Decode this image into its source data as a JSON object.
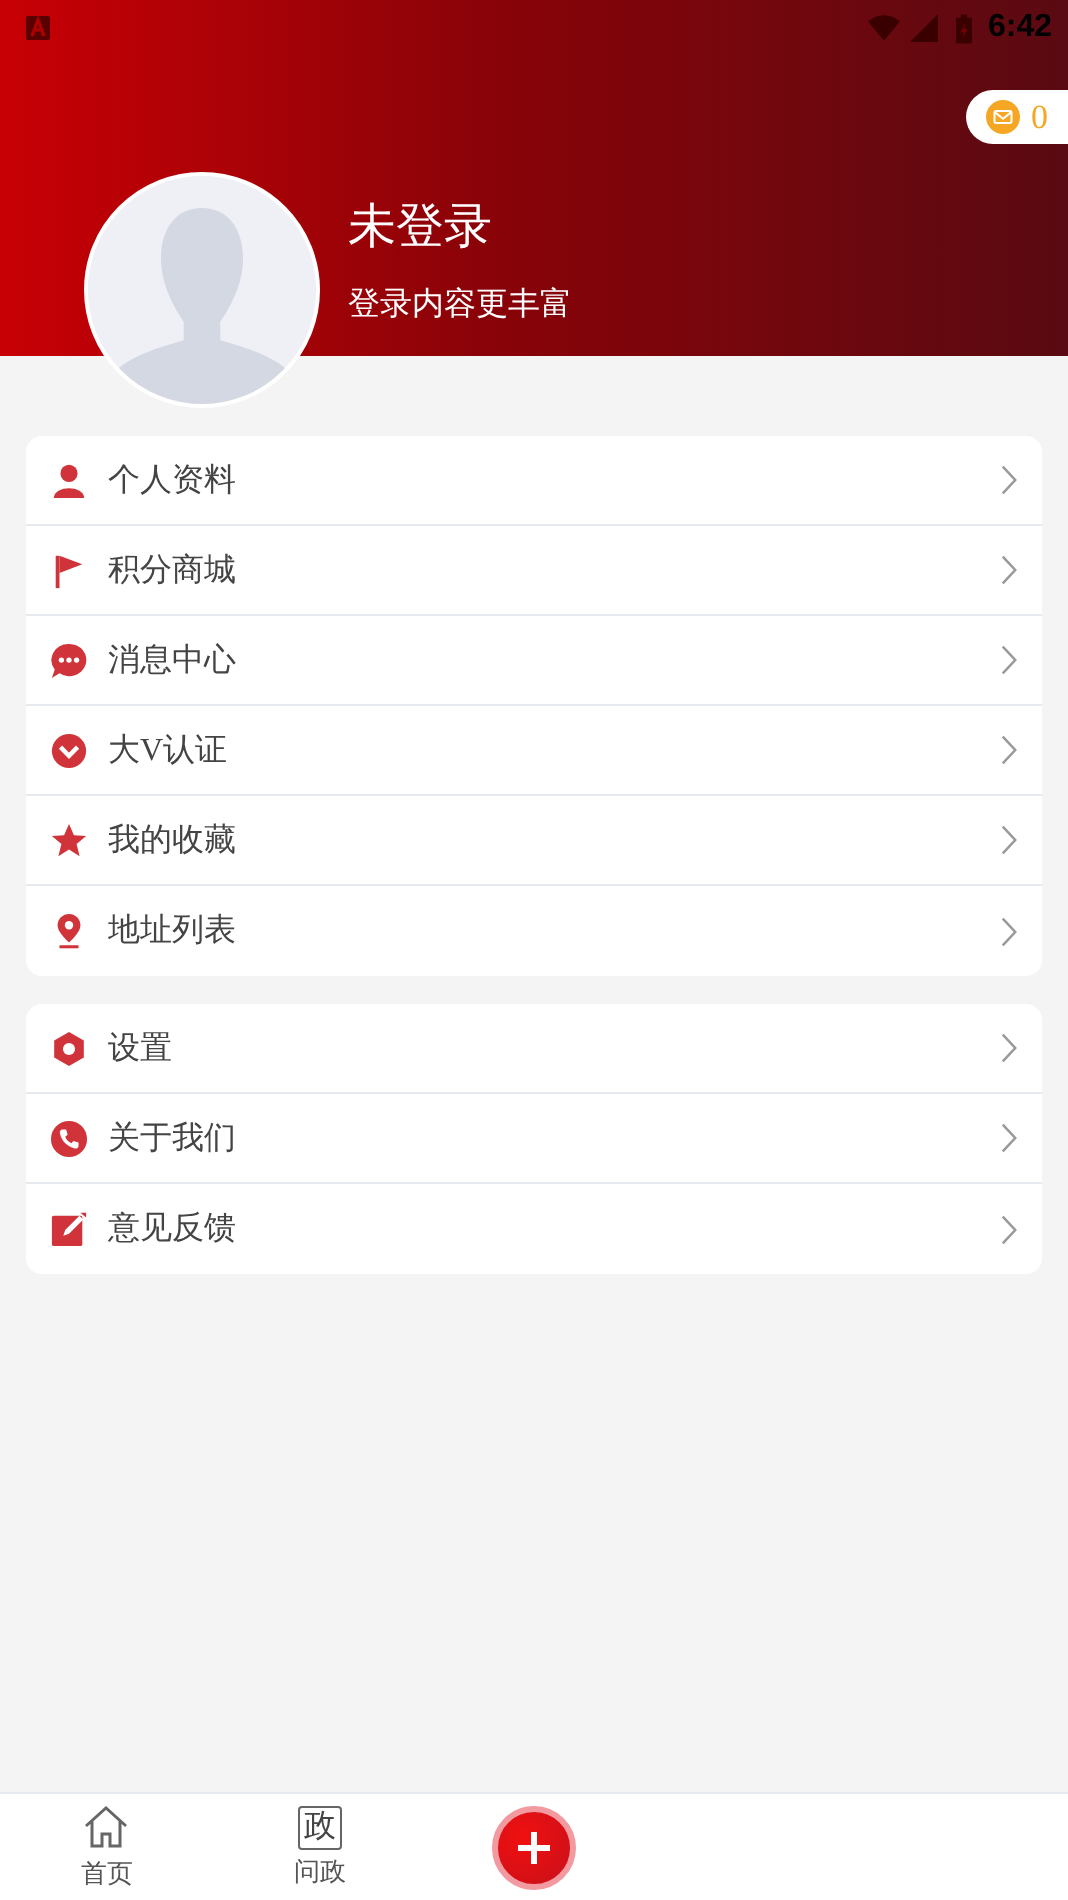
{
  "status_bar": {
    "time": "6:42"
  },
  "profile": {
    "name": "未登录",
    "subtitle": "登录内容更丰富",
    "coins": "0"
  },
  "menu_groups": [
    {
      "items": [
        {
          "label": "个人资料",
          "kind": "person"
        },
        {
          "label": "积分商城",
          "kind": "flag"
        },
        {
          "label": "消息中心",
          "kind": "chat"
        },
        {
          "label": "大V认证",
          "kind": "badge"
        },
        {
          "label": "我的收藏",
          "kind": "star"
        },
        {
          "label": "地址列表",
          "kind": "pin"
        }
      ]
    },
    {
      "items": [
        {
          "label": "设置",
          "kind": "gear"
        },
        {
          "label": "关于我们",
          "kind": "phone"
        },
        {
          "label": "意见反馈",
          "kind": "edit"
        }
      ]
    }
  ],
  "bottom_nav": [
    {
      "label": "首页",
      "kind": "home"
    },
    {
      "label": "问政",
      "kind": "text_icon",
      "icon_text": "政"
    },
    {
      "kind": "add"
    }
  ]
}
